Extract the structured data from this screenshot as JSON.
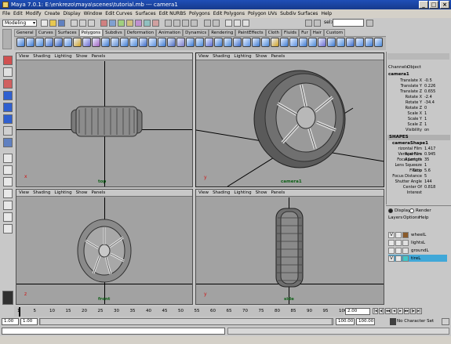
{
  "title_bar": {
    "title": "Maya 7.0.1: E:\\enkrezo\\maya\\scenes\\tutorial.mb    ---   camera1"
  },
  "menu": [
    "File",
    "Edit",
    "Modify",
    "Create",
    "Display",
    "Window",
    "Edit Curves",
    "Surfaces",
    "Edit NURBS",
    "Polygons",
    "Edit Polygons",
    "Polygon UVs",
    "Subdiv Surfaces",
    "Help"
  ],
  "status_line": {
    "mode": "Modeling",
    "sel_label": "sel>"
  },
  "shelf_tabs": [
    "General",
    "Curves",
    "Surfaces",
    "Polygons",
    "Subdivs",
    "Deformation",
    "Animation",
    "Dynamics",
    "Rendering",
    "PaintEffects",
    "Cloth",
    "Fluids",
    "Fur",
    "Hair",
    "Custom"
  ],
  "shelf_active_tab": "Polygons",
  "panel_menu": [
    "View",
    "Shading",
    "Lighting",
    "Show",
    "Panels"
  ],
  "viewports": [
    {
      "id": "top",
      "camera": "top"
    },
    {
      "id": "persp",
      "camera": "camera1"
    },
    {
      "id": "front",
      "camera": "front"
    },
    {
      "id": "side",
      "camera": "side"
    }
  ],
  "channel_box": {
    "tabs": [
      "Channels",
      "Object"
    ],
    "object_name": "camera1",
    "attributes": [
      {
        "name": "Translate X",
        "value": "-0.5"
      },
      {
        "name": "Translate Y",
        "value": "0.226"
      },
      {
        "name": "Translate Z",
        "value": "0.655"
      },
      {
        "name": "Rotate X",
        "value": "-2.4"
      },
      {
        "name": "Rotate Y",
        "value": "-34.4"
      },
      {
        "name": "Rotate Z",
        "value": "0"
      },
      {
        "name": "Scale X",
        "value": "1"
      },
      {
        "name": "Scale Y",
        "value": "1"
      },
      {
        "name": "Scale Z",
        "value": "1"
      },
      {
        "name": "Visibility",
        "value": "on"
      }
    ],
    "shapes_header": "SHAPES",
    "shape_name": "cameraShape1",
    "shape_attributes": [
      {
        "name": "rizontal Film Aperture",
        "value": "1.417"
      },
      {
        "name": "Vertical Film Aperture",
        "value": "0.945"
      },
      {
        "name": "Focal Length",
        "value": "35"
      },
      {
        "name": "Lens Squeeze Ratio",
        "value": "1"
      },
      {
        "name": "F Stop",
        "value": "5.6"
      },
      {
        "name": "Focus Distance",
        "value": "5"
      },
      {
        "name": "Shutter Angle",
        "value": "144"
      },
      {
        "name": "Center Of Interest",
        "value": "0.818"
      }
    ]
  },
  "layer_editor": {
    "radio_display": "Display",
    "radio_render": "Render",
    "menu": [
      "Layers",
      "Options",
      "Help"
    ],
    "layers": [
      {
        "name": "wheelL",
        "visible": "V",
        "color": "#8a5a2a"
      },
      {
        "name": "lightsL",
        "visible": "",
        "color": "#e0e0e0"
      },
      {
        "name": "groundL",
        "visible": "",
        "color": "#e0e0e0"
      },
      {
        "name": "tireL",
        "visible": "V",
        "color": "#40c8c8",
        "selected": true
      }
    ]
  },
  "time_slider": {
    "ticks": [
      "1",
      "5",
      "10",
      "15",
      "20",
      "25",
      "30",
      "35",
      "40",
      "45",
      "50",
      "55",
      "60",
      "65",
      "70",
      "75",
      "80",
      "85",
      "90",
      "95",
      "100"
    ],
    "current_frame": "2.00"
  },
  "range_slider": {
    "start_time": "1.00",
    "playback_start": "1.00",
    "playback_end": "100.00",
    "end_time": "100.00",
    "character_set": "No Character Set"
  }
}
